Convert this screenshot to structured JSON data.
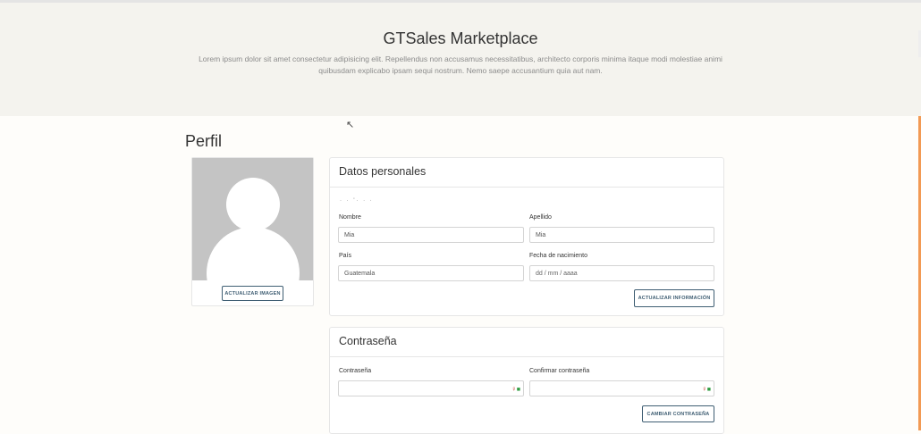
{
  "header": {
    "title": "GTSales Marketplace",
    "description": "Lorem ipsum dolor sit amet consectetur adipisicing elit. Repellendus non accusamus necessitatibus, architecto corporis minima itaque modi molestiae animi quibusdam explicabo ipsam sequi nostrum. Nemo saepe accusantium quia aut nam."
  },
  "profile": {
    "title": "Perfil",
    "update_image_label": "ACTUALIZAR IMAGEN"
  },
  "personal": {
    "title": "Datos personales",
    "first_name_label": "Nombre",
    "first_name_value": "Mia",
    "last_name_label": "Apellido",
    "last_name_value": "Mia",
    "country_label": "País",
    "country_value": "Guatemala",
    "birthdate_label": "Fecha de nacimiento",
    "birthdate_placeholder": "dd / mm / aaaa",
    "update_info_label": "ACTUALIZAR INFORMACIÓN"
  },
  "password": {
    "title": "Contraseña",
    "password_label": "Contraseña",
    "confirm_label": "Confirmar contraseña",
    "change_label": "CAMBIAR CONTRASEÑA"
  },
  "icons": {
    "cursor": "mouse-pointer-icon",
    "password_manager": "password-key-icon"
  },
  "colors": {
    "hero_bg": "#f4f3ee",
    "button_border": "#3f5e73",
    "accent": "#f29a54"
  }
}
